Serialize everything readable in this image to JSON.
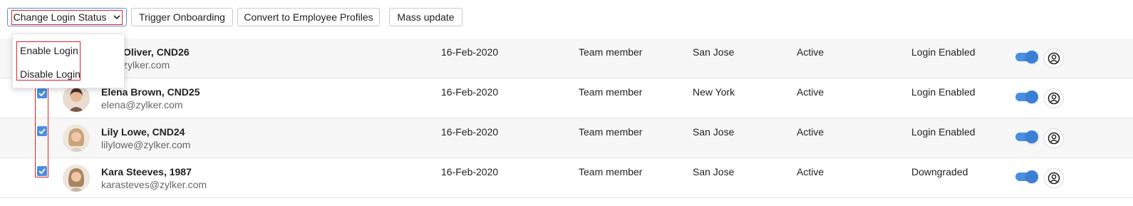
{
  "toolbar": {
    "change_login_status": "Change Login Status",
    "trigger_onboarding": "Trigger Onboarding",
    "convert_profiles": "Convert to Employee Profiles",
    "mass_update": "Mass update"
  },
  "dropdown": {
    "items": [
      "Enable Login",
      "Disable Login"
    ]
  },
  "rows": [
    {
      "name": "Oliver, CND26",
      "email": "zylker.com",
      "date": "16-Feb-2020",
      "role": "Team member",
      "location": "San Jose",
      "status": "Active",
      "login": "Login Enabled",
      "checked": true
    },
    {
      "name": "Elena Brown, CND25",
      "email": "elena@zylker.com",
      "date": "16-Feb-2020",
      "role": "Team member",
      "location": "New York",
      "status": "Active",
      "login": "Login Enabled",
      "checked": true
    },
    {
      "name": "Lily Lowe, CND24",
      "email": "lilylowe@zylker.com",
      "date": "16-Feb-2020",
      "role": "Team member",
      "location": "San Jose",
      "status": "Active",
      "login": "Login Enabled",
      "checked": true
    },
    {
      "name": "Kara Steeves, 1987",
      "email": "karasteves@zylker.com",
      "date": "16-Feb-2020",
      "role": "Team member",
      "location": "San Jose",
      "status": "Active",
      "login": "Downgraded",
      "checked": true
    }
  ],
  "colors": {
    "accent": "#4a8fe0",
    "highlight_box": "#d9262c"
  },
  "icons": {
    "checkbox": "checkbox-checked-icon",
    "toggle": "toggle-on-icon",
    "action": "user-circle-icon",
    "dropdown": "chevron-down-icon"
  }
}
